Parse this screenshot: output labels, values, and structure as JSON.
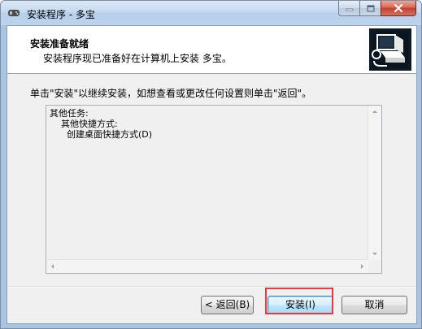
{
  "window": {
    "title": "安装程序 - 多宝",
    "icon": "installer-app-icon",
    "caption_icons": [
      "minimize-icon",
      "maximize-icon",
      "close-icon"
    ]
  },
  "header": {
    "title": "安装准备就绪",
    "subtitle": "安装程序现已准备好在计算机上安装 多宝。",
    "image": "computer-install-icon"
  },
  "body": {
    "instruction": "单击\"安装\"以继续安装，如想查看或更改任何设置则单击\"返回\"。",
    "memo_lines": [
      "其他任务:",
      "    其他快捷方式:",
      "      创建桌面快捷方式(D)"
    ]
  },
  "buttons": {
    "back": "< 返回(B)",
    "install": "安装(I)",
    "cancel": "取消"
  },
  "colors": {
    "highlight": "#e8393a",
    "title_bar": "#c7daf1",
    "client_bg": "#f0f0f0"
  }
}
